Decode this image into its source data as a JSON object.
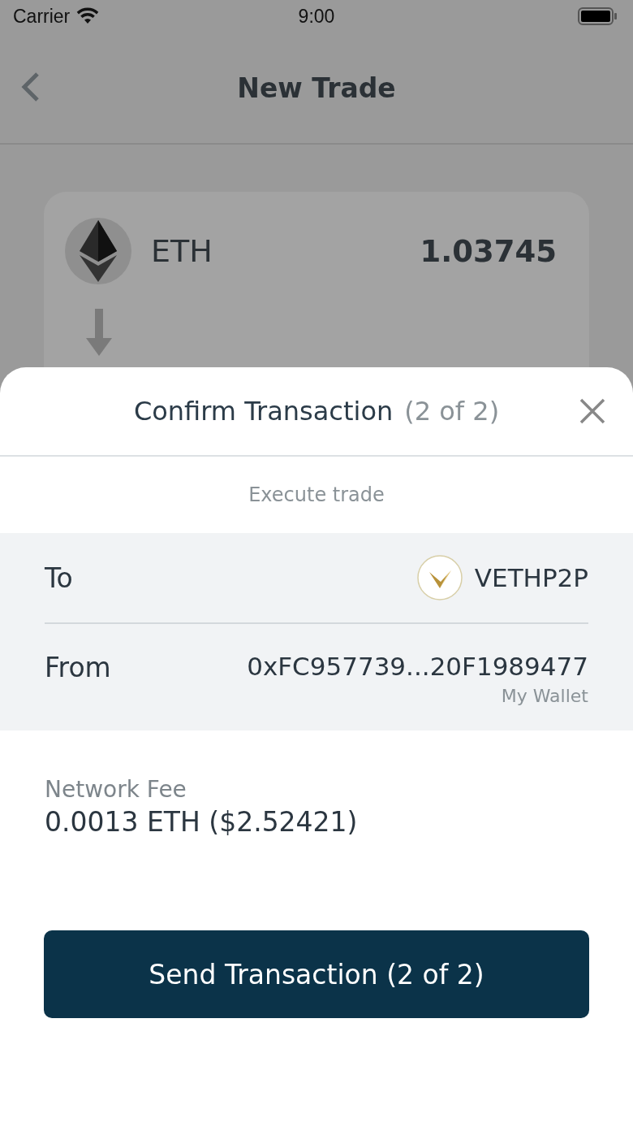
{
  "status_bar": {
    "carrier": "Carrier",
    "time": "9:00"
  },
  "nav": {
    "title": "New Trade"
  },
  "trade_card": {
    "token": "ETH",
    "amount": "1.03745"
  },
  "sheet": {
    "title": "Confirm Transaction",
    "step": "(2 of 2)",
    "subtitle": "Execute trade",
    "to": {
      "label": "To",
      "value": "VETHP2P"
    },
    "from": {
      "label": "From",
      "address": "0xFC957739...20F1989477",
      "wallet": "My Wallet"
    },
    "fee": {
      "label": "Network Fee",
      "value": "0.0013 ETH ($2.52421)"
    },
    "button": "Send Transaction (2 of 2)"
  }
}
